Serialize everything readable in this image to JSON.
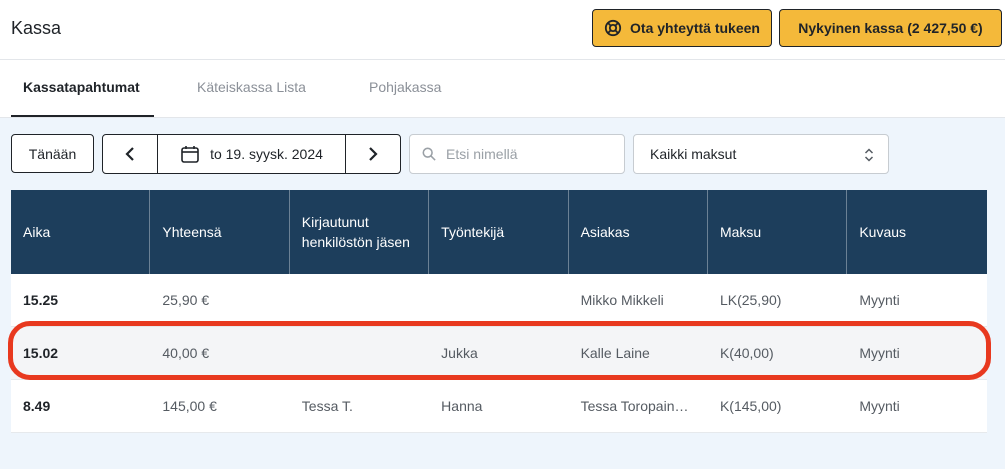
{
  "header": {
    "title": "Kassa",
    "support_label": "Ota yhteyttä tukeen",
    "current_kassa_label": "Nykyinen kassa (2 427,50 €)",
    "accent_color": "#f4b93a"
  },
  "tabs": [
    {
      "label": "Kassatapahtumat",
      "active": true
    },
    {
      "label": "Käteiskassa Lista",
      "active": false
    },
    {
      "label": "Pohjakassa",
      "active": false
    }
  ],
  "toolbar": {
    "today_label": "Tänään",
    "prev_icon": "chevron-left-icon",
    "next_icon": "chevron-right-icon",
    "date_label": "to 19. syysk. 2024",
    "search_placeholder": "Etsi nimellä",
    "filter_selected": "Kaikki maksut"
  },
  "table": {
    "header_color": "#1d3e5c",
    "columns": [
      "Aika",
      "Yhteensä",
      "Kirjautunut henkilöstön jäsen",
      "Työntekijä",
      "Asiakas",
      "Maksu",
      "Kuvaus"
    ],
    "rows": [
      [
        "15.25",
        "25,90 €",
        "",
        "",
        "Mikko Mikkeli",
        "LK(25,90)",
        "Myynti"
      ],
      [
        "15.02",
        "40,00 €",
        "",
        "Jukka",
        "Kalle Laine",
        "K(40,00)",
        "Myynti"
      ],
      [
        "8.49",
        "145,00 €",
        "Tessa T.",
        "Hanna",
        "Tessa Toropain…",
        "K(145,00)",
        "Myynti"
      ]
    ]
  },
  "highlight_color": "#e8391f"
}
